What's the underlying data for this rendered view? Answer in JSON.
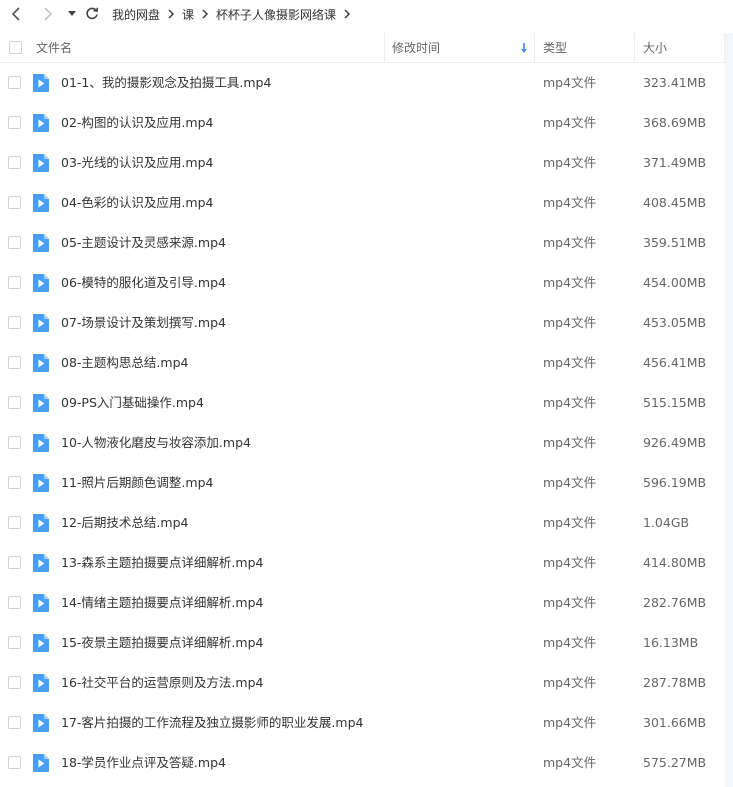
{
  "nav": {
    "back_icon": "chevron-left-icon",
    "forward_icon": "chevron-right-icon",
    "dropdown_icon": "caret-down-icon",
    "refresh_icon": "refresh-icon"
  },
  "breadcrumb": [
    "我的网盘",
    "课",
    "杯杯子人像摄影网络课"
  ],
  "columns": {
    "name": "文件名",
    "modified": "修改时间",
    "type": "类型",
    "size": "大小"
  },
  "colors": {
    "accent": "#3b8cf5",
    "icon_blue": "#4a9ff5",
    "sort_arrow": "#3b8cf5"
  },
  "files": [
    {
      "name": "01-1、我的摄影观念及拍摄工具.mp4",
      "type": "mp4文件",
      "size": "323.41MB"
    },
    {
      "name": "02-构图的认识及应用.mp4",
      "type": "mp4文件",
      "size": "368.69MB"
    },
    {
      "name": "03-光线的认识及应用.mp4",
      "type": "mp4文件",
      "size": "371.49MB"
    },
    {
      "name": "04-色彩的认识及应用.mp4",
      "type": "mp4文件",
      "size": "408.45MB"
    },
    {
      "name": "05-主题设计及灵感来源.mp4",
      "type": "mp4文件",
      "size": "359.51MB"
    },
    {
      "name": "06-模特的服化道及引导.mp4",
      "type": "mp4文件",
      "size": "454.00MB"
    },
    {
      "name": "07-场景设计及策划撰写.mp4",
      "type": "mp4文件",
      "size": "453.05MB"
    },
    {
      "name": "08-主题构思总结.mp4",
      "type": "mp4文件",
      "size": "456.41MB"
    },
    {
      "name": "09-PS入门基础操作.mp4",
      "type": "mp4文件",
      "size": "515.15MB"
    },
    {
      "name": "10-人物液化磨皮与妆容添加.mp4",
      "type": "mp4文件",
      "size": "926.49MB"
    },
    {
      "name": "11-照片后期颜色调整.mp4",
      "type": "mp4文件",
      "size": "596.19MB"
    },
    {
      "name": "12-后期技术总结.mp4",
      "type": "mp4文件",
      "size": "1.04GB"
    },
    {
      "name": "13-森系主题拍摄要点详细解析.mp4",
      "type": "mp4文件",
      "size": "414.80MB"
    },
    {
      "name": "14-情绪主题拍摄要点详细解析.mp4",
      "type": "mp4文件",
      "size": "282.76MB"
    },
    {
      "name": "15-夜景主题拍摄要点详细解析.mp4",
      "type": "mp4文件",
      "size": "16.13MB"
    },
    {
      "name": "16-社交平台的运营原则及方法.mp4",
      "type": "mp4文件",
      "size": "287.78MB"
    },
    {
      "name": "17-客片拍摄的工作流程及独立摄影师的职业发展.mp4",
      "type": "mp4文件",
      "size": "301.66MB"
    },
    {
      "name": "18-学员作业点评及答疑.mp4",
      "type": "mp4文件",
      "size": "575.27MB"
    }
  ]
}
